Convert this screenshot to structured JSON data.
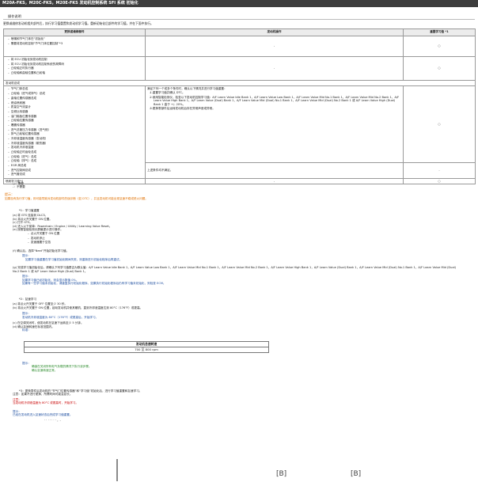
{
  "header": {
    "title": "M20A-FKS，M20C-FKS，M20E-FKS 发动机控制系统 SFI 系统 初始化"
  },
  "section": {
    "title": "操作说明"
  },
  "intro": "更换或维修发动机相关部件后，执行学习值重置和发动机学习值。重新初始化后部件的学习值，并在下面中执行。",
  "table": {
    "headers": [
      "更换或维修部件",
      "发动机操作",
      "重置学习值 *1"
    ],
    "rows": [
      {
        "col1": [
          "喷嘴和节气门体在“初始化”",
          "需要将发动机控制“节气门体位置控制”*3"
        ],
        "col2": "-",
        "col3": "○"
      },
      {
        "col1": [
          "将 ECU 初始化到发动机控制",
          "将 ECU 初始化到发动机控制系统的故障码",
          "凸轮轴正时执行器",
          "凸轮轴和曲轴位置和凸轮轴"
        ],
        "col2": "-",
        "col3": "○"
      },
      {
        "col1": [
          "发动机总成"
        ],
        "col2": "",
        "col3": "",
        "span": true
      },
      {
        "col1": [
          "节气门体总成",
          "凸轮轴（进气或排气）总成",
          "曲轴位置传感器总成",
          "燃油喷射器",
          "质量空气流量计",
          "空燃比传感器",
          "油门踏板位置传感器",
          "凸轮轴位置传感器",
          "爆震传感器",
          "进气总管压力传感器（进气侧）",
          "排气凸轮轴位置传感器",
          "冷却液温度传感器（发动机）",
          "冷却液温度传感器（散热器）",
          "发动机冷却液温度",
          "凸轮轴正时齿轮总成",
          "凸轮轴（进气）总成",
          "凸轮轴（排气）总成",
          "EGR 阀总成",
          "进气控制阀总成",
          "进气管总成"
        ],
        "col2_title": "满足下列一个或多个条件时，确认以下情况并进行学习值重置：",
        "col2_items": [
          "重置学习值并确认 DTC。",
          "使用智能检测仪，检查以下发动机控制学习值：A/F Learn Value Idle Bank 1，A/F Learn Value Low Bank 1，A/F Learn Value Mid No.1 Bank 1，A/F Learn Value Mid No.2 Bank 1，A/F Learn Value High Bank 1，A/F Learn Value (Dual) Bank 1，A/F Learn Value Mid (Dual) No.1 Bank 1，A/F Learn Value Mid (Dual) No.2 Bank 1 或 A/F Learn Value High (Dual) Bank 1 高于 +/- 20%。",
          "更换零部件后运转发动机后存在异常声音或异常。"
        ],
        "col3": "○",
        "col2b": "上述条件均不满足。",
        "col3b": "-"
      },
      {
        "col1": [
          "喷射学习值*4"
        ],
        "col2": "-",
        "col3": "○"
      }
    ]
  },
  "footnotes": [
    "○：需要",
    "-：不需要"
  ],
  "note_label": "提示：",
  "note_orange": "如果没有执行学习值，则可能导致对发动机部件的误诊断（如 DTC），并且发动机可能出现怠速不稳或熄火问题。",
  "step1": {
    "title": "*1：学习值重置",
    "steps": [
      "(a) 将 GTS 连接到 DLC3。",
      "(b) 将点火开关置于 ON 位置。",
      "(c) 打开 GTS。",
      "(d) 进入以下菜单：Powertrain / Engine / Utility / Learning Value Reset。",
      "(e) 按照智能检测仪屏幕提示进行操作。"
    ],
    "bullets": [
      "点火开关置于 ON 位置",
      "发动机停止",
      "变速器置于空挡"
    ],
    "f": "(f) 确认后，选择“Next”开始初始化学习值。",
    "f_note_label": "提示：",
    "f_note": "如果学习值重置在学习值初始化期间失败，则重新进行初始化程序后再重试。",
    "g": "(g) 完成学习值初始化后，请确认下列学习值是否为默认值：A/F Learn Value Idle Bank 1，A/F Learn Value Low Bank 1，A/F Learn Value Mid No.1 Bank 1，A/F Learn Value Mid No.2 Bank 1，A/F Learn Value High Bank 1，A/F Learn Value (Dual) Bank 1，A/F Learn Value Mid (Dual) No.1 Bank 1，A/F Learn Value Mid (Dual) No.2 Bank 1 或 A/F Learn Value High (Dual) Bank 1。",
    "g_note_label": "提示：",
    "g_note": [
      "如果学习值已经初始化，则会显示数值 0%。",
      "如果有一些学习值未初始化，请重复执行初始化程序。如果执行初始化程序后仍有学习值未初始化，则检查 ECM。"
    ]
  },
  "step2": {
    "title": "*2：怠速学习",
    "steps": [
      "(a) 将点火开关置于 OFF 位置至少 30 秒。",
      "(b) 将点火开关置于 ON 位置，起动发动机并使其暖机，直到冷却液温度达到 80°C（176°F）或更高。",
      "(c) 在空调关闭时，使发动机在怠速下运转至少 5 分钟。",
      "(d) 确认怠速转速在标准范围内。"
    ],
    "b_note_label": "提示：",
    "b_note": "发动机冷却液温度为 80°C（176°F）或更高后，开始学习。",
    "std_label": "标准：",
    "std_header": "发动机怠速转速",
    "std_value": "700 至 800 rpm",
    "d_note_label": "提示：",
    "d_note": [
      "确保在关闭所有电气负载的情况下执行该步骤。",
      "确认怠速转速正常。"
    ]
  },
  "step3": {
    "line1": "*3：更换零件后发动机的“节气门位置传感器”和“学习值”初始化后，进行学习值重置和怠速学习。",
    "line2": "注意：如果不进行更换，所需时间可能会延长。",
    "warn_label": "注意：",
    "warn": "当发动机冷却液温度为 80°C 或更高时，开始学习。",
    "hint_label": "提示：",
    "hint": "已经在发动机进入怠速状态后完成学习值重置。",
    "tail": "· · · · · · · ，-"
  },
  "footer": {
    "b1": "[B]",
    "b2": "[B]"
  }
}
